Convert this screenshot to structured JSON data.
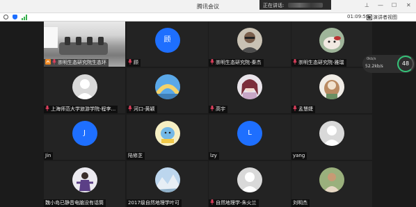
{
  "window": {
    "title": "腾讯会议",
    "speaking_label": "正在讲话:",
    "controls": {
      "pin": "⊥",
      "minimize": "—",
      "maximize": "☐",
      "close": "✕"
    }
  },
  "toolbar": {
    "timer": "01:09:59",
    "view_label": "演讲者视图"
  },
  "network": {
    "up": "0kb/s",
    "down": "52.2kb/s",
    "cpu": "48"
  },
  "colors": {
    "accent": "#1e6fff",
    "mic_icon": "#e0405e",
    "tile": "#232323",
    "background": "#1b1b1b"
  },
  "participants": [
    {
      "name": "崇明生态研究院生态环",
      "avatar": "video-room"
    },
    {
      "name": "顾",
      "avatar": "letter",
      "letter": "顾",
      "color": "#1e6fff"
    },
    {
      "name": "崇明生态研究院-秦杰",
      "avatar": "photo-person-glasses"
    },
    {
      "name": "崇明生态研究院-雅瑞",
      "avatar": "photo-dog"
    },
    {
      "name": "上海师范大学旅游学院-程李...",
      "avatar": "default-person"
    },
    {
      "name": "河口-黄颖",
      "avatar": "photo-sky-arc"
    },
    {
      "name": "高宇",
      "avatar": "photo-anime-girl"
    },
    {
      "name": "孟慧婕",
      "avatar": "photo-cat-plush"
    },
    {
      "name": "Jin",
      "avatar": "letter",
      "letter": "J",
      "color": "#1e6fff"
    },
    {
      "name": "陆修芝",
      "avatar": "photo-cartoon-blue"
    },
    {
      "name": "lzy",
      "avatar": "letter",
      "letter": "L",
      "color": "#1e6fff"
    },
    {
      "name": "yang",
      "avatar": "default-person"
    },
    {
      "name": "魏小岛已静音电脑没有话筒",
      "avatar": "photo-person-purple"
    },
    {
      "name": "2017级自然地理学叶可",
      "avatar": "photo-landscape"
    },
    {
      "name": "自然地理学-朱火兰",
      "avatar": "default-person"
    },
    {
      "name": "刘明杰",
      "avatar": "photo-man-outdoor"
    }
  ]
}
